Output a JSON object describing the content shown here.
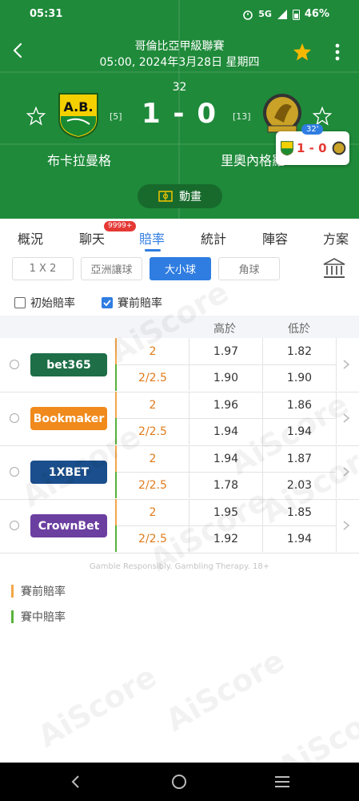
{
  "status_bar": {
    "time": "05:31",
    "network": "5G",
    "battery": "46%"
  },
  "match": {
    "league": "哥倫比亞甲級聯賽",
    "datetime": "05:00, 2024年3月28日 星期四",
    "minute": "32",
    "score": "1 - 0",
    "home": {
      "name": "布卡拉曼格",
      "rank": "[5]"
    },
    "away": {
      "name": "里奧內格羅",
      "rank": "[13]"
    },
    "animation_label": "動畫"
  },
  "mini_score": {
    "minute": "32'",
    "score": "1 - 0"
  },
  "tabs": [
    {
      "label": "概況"
    },
    {
      "label": "聊天"
    },
    {
      "label": "賠率"
    },
    {
      "label": "統計"
    },
    {
      "label": "陣容"
    },
    {
      "label": "方案"
    }
  ],
  "chat_badge": "9999+",
  "active_tab": "賠率",
  "segments": [
    {
      "label": "1 X 2"
    },
    {
      "label": "亞洲讓球"
    },
    {
      "label": "大小球"
    },
    {
      "label": "角球"
    }
  ],
  "active_segment": "大小球",
  "filters": {
    "initial": {
      "label": "初始賠率",
      "checked": false
    },
    "pre": {
      "label": "賽前賠率",
      "checked": true
    }
  },
  "table": {
    "header_over": "高於",
    "header_under": "低於",
    "rows": [
      {
        "bookmaker": "bet365",
        "color": "#1e6e47",
        "pre": {
          "line": "2",
          "over": "1.97",
          "under": "1.82"
        },
        "live": {
          "line": "2/2.5",
          "over": "1.90",
          "under": "1.90"
        }
      },
      {
        "bookmaker": "Bookmaker",
        "color": "#f08a1c",
        "pre": {
          "line": "2",
          "over": "1.96",
          "under": "1.86"
        },
        "live": {
          "line": "2/2.5",
          "over": "1.94",
          "under": "1.94"
        }
      },
      {
        "bookmaker": "1XBET",
        "color": "#1a4e8c",
        "pre": {
          "line": "2",
          "over": "1.94",
          "under": "1.87"
        },
        "live": {
          "line": "2/2.5",
          "over": "1.78",
          "under": "2.03"
        }
      },
      {
        "bookmaker": "CrownBet",
        "color": "#6b3fa0",
        "pre": {
          "line": "2",
          "over": "1.95",
          "under": "1.85"
        },
        "live": {
          "line": "2/2.5",
          "over": "1.92",
          "under": "1.94"
        }
      }
    ]
  },
  "disclaimer": "Gamble Responsibly. Gambling Therapy. 18+",
  "legend": {
    "pre": "賽前賠率",
    "live": "賽中賠率",
    "pre_color": "#f4a64a",
    "live_color": "#58b33a"
  },
  "watermark": "AiScore"
}
